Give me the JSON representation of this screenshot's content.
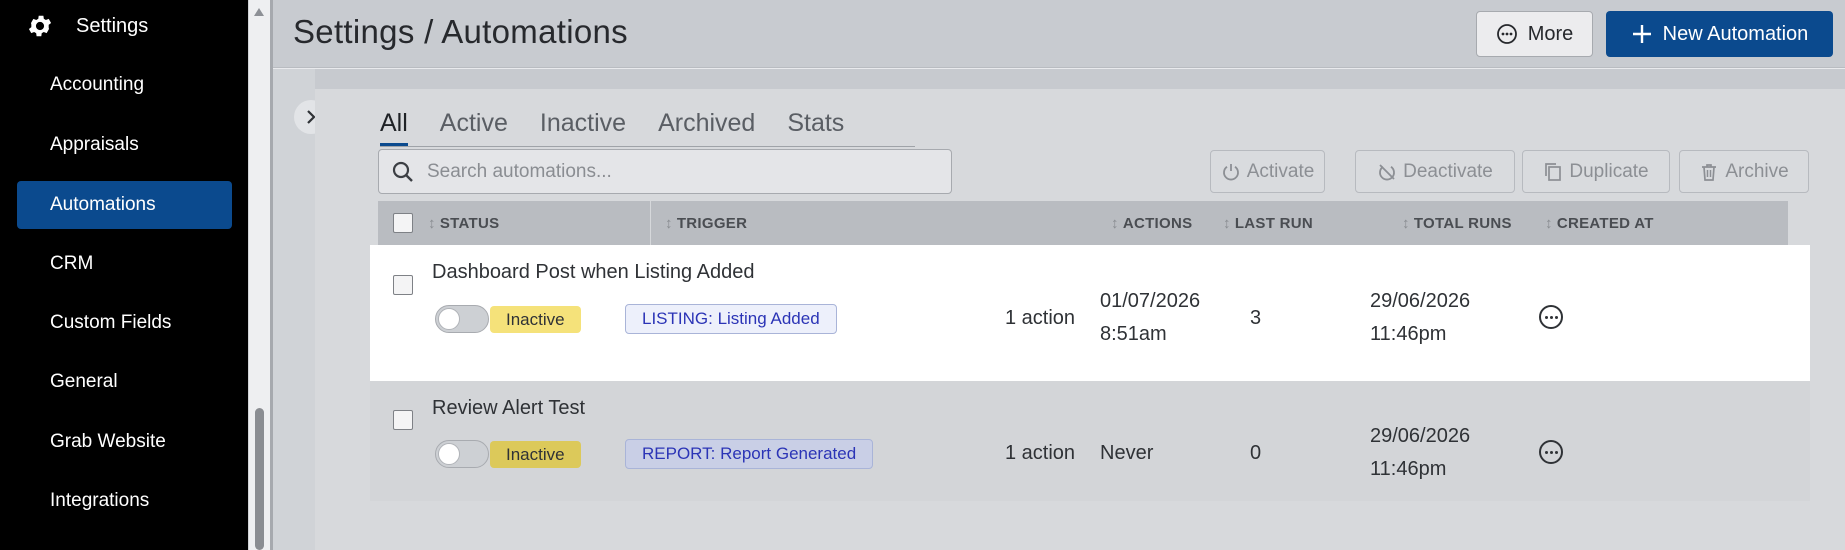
{
  "sidebar": {
    "header_label": "Settings",
    "items": [
      {
        "label": "Accounting"
      },
      {
        "label": "Appraisals"
      },
      {
        "label": "Automations"
      },
      {
        "label": "CRM"
      },
      {
        "label": "Custom Fields"
      },
      {
        "label": "General"
      },
      {
        "label": "Grab Website"
      },
      {
        "label": "Integrations"
      }
    ],
    "active_item": "Automations"
  },
  "header": {
    "title": "Settings / Automations",
    "more_label": "More",
    "new_label": "New Automation"
  },
  "tabs": [
    {
      "label": "All"
    },
    {
      "label": "Active"
    },
    {
      "label": "Inactive"
    },
    {
      "label": "Archived"
    },
    {
      "label": "Stats"
    }
  ],
  "active_tab": "All",
  "search": {
    "placeholder": "Search automations...",
    "value": ""
  },
  "actions": {
    "activate": "Activate",
    "deactivate": "Deactivate",
    "duplicate": "Duplicate",
    "archive": "Archive"
  },
  "table": {
    "columns": {
      "status": "STATUS",
      "trigger": "TRIGGER",
      "actions": "ACTIONS",
      "last_run": "LAST RUN",
      "total_runs": "TOTAL RUNS",
      "created_at": "CREATED AT"
    },
    "rows": [
      {
        "name": "Dashboard Post when Listing Added",
        "status": "Inactive",
        "trigger": "LISTING: Listing Added",
        "actions": "1 action",
        "last_run_date": "01/07/2026",
        "last_run_time": "8:51am",
        "total_runs": "3",
        "created_date": "29/06/2026",
        "created_time": "11:46pm"
      },
      {
        "name": "Review Alert Test",
        "status": "Inactive",
        "trigger": "REPORT: Report Generated",
        "actions": "1 action",
        "last_run_date": "Never",
        "total_runs": "0",
        "created_date": "29/06/2026",
        "created_time": "11:46pm"
      }
    ]
  },
  "colors": {
    "accent": "#0b4a8e",
    "badge_inactive_row1": "#f5e27a",
    "badge_inactive_row2": "#dcc95a",
    "trigger_bg_row1": "#edf0fb",
    "trigger_bg_row2": "#c9cfe6"
  }
}
